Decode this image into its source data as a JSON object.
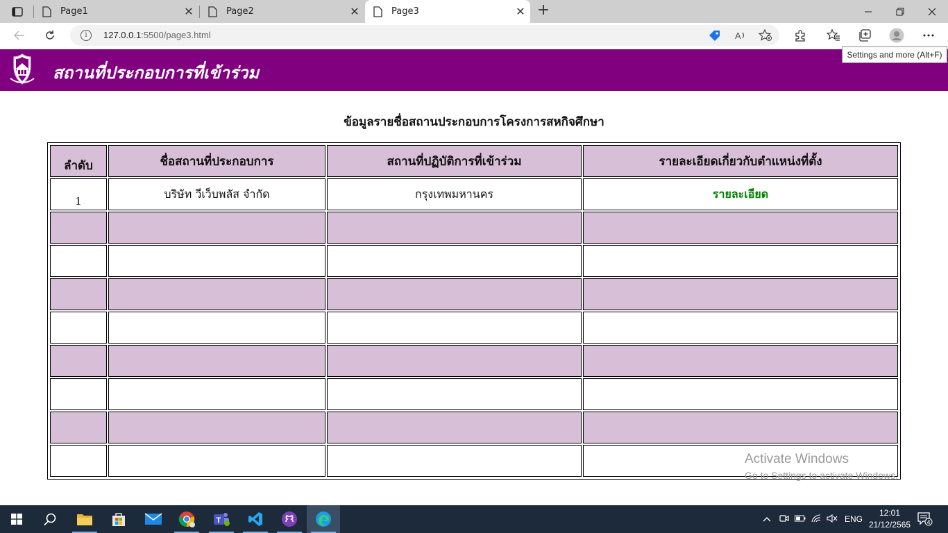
{
  "browser": {
    "tabs": [
      {
        "title": "Page1",
        "active": false
      },
      {
        "title": "Page2",
        "active": false
      },
      {
        "title": "Page3",
        "active": true
      }
    ],
    "url_host": "127.0.0.1",
    "url_path": ":5500/page3.html",
    "tooltip": "Settings and more (Alt+F)"
  },
  "header": {
    "title": "สถานที่ประกอบการที่เข้าร่วม",
    "background_color": "#800080"
  },
  "content": {
    "title": "ข้อมูลรายชื่อสถานประกอบการโครงการสหกิจศึกษา",
    "columns": [
      "ลำดับ",
      "ชื่อสถานที่ประกอบการ",
      "สถานที่ปฏิบัติการที่เข้าร่วม",
      "รายละเอียดเกี่ยวกับตำแหน่งที่ตั้ง"
    ],
    "rows": [
      {
        "order": "1",
        "name": "บริษัท วีเว็บพลัส จำกัด",
        "location": "กรุงเทพมหานคร",
        "detail": "รายละเอียด"
      },
      {
        "order": "",
        "name": "",
        "location": "",
        "detail": ""
      },
      {
        "order": "",
        "name": "",
        "location": "",
        "detail": ""
      },
      {
        "order": "",
        "name": "",
        "location": "",
        "detail": ""
      },
      {
        "order": "",
        "name": "",
        "location": "",
        "detail": ""
      },
      {
        "order": "",
        "name": "",
        "location": "",
        "detail": ""
      },
      {
        "order": "",
        "name": "",
        "location": "",
        "detail": ""
      },
      {
        "order": "",
        "name": "",
        "location": "",
        "detail": ""
      },
      {
        "order": "",
        "name": "",
        "location": "",
        "detail": ""
      }
    ],
    "header_bg": "#d8bfd8",
    "link_color": "#008000"
  },
  "watermark": {
    "line1": "Activate Windows",
    "line2": "Go to Settings to activate Windows."
  },
  "taskbar": {
    "language": "ENG",
    "time": "12:01",
    "date": "21/12/2565",
    "notification_count": "4"
  }
}
